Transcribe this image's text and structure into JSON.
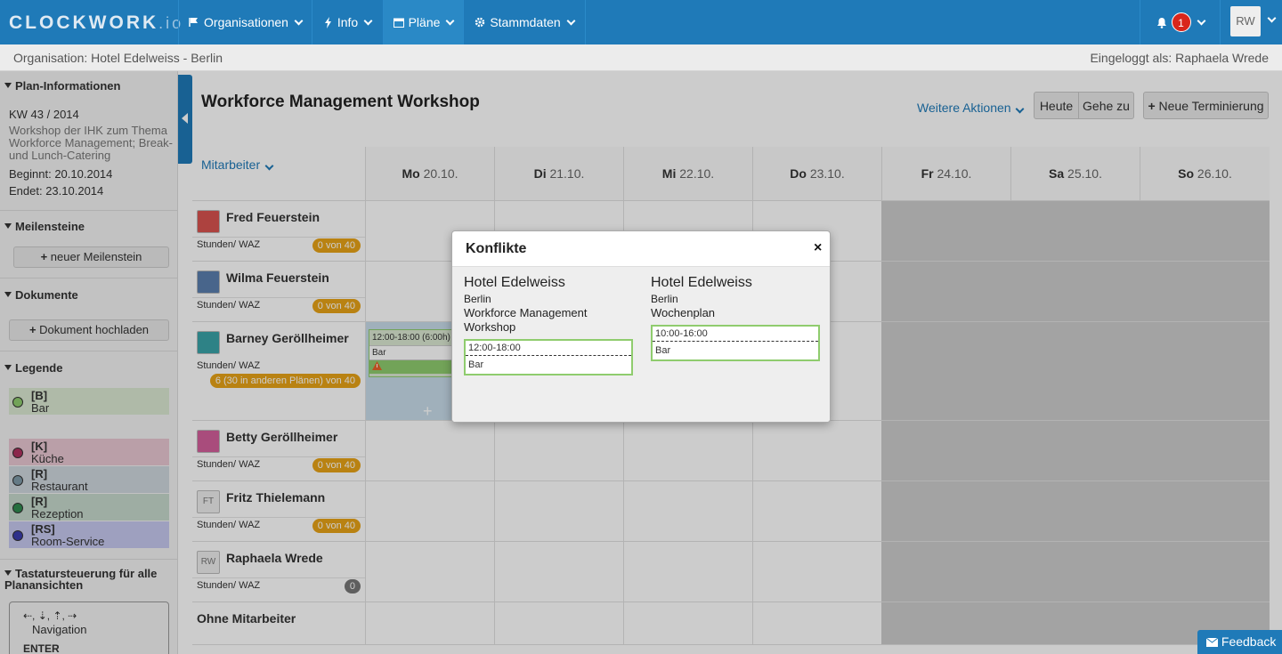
{
  "app": {
    "logo": "CL",
    "logo_o": "O",
    "logo_rest": "CKWORK",
    "logo_tld": ".io"
  },
  "nav": {
    "items": [
      {
        "label": "Organisationen",
        "icon": "flag-icon"
      },
      {
        "label": "Info",
        "icon": "bolt-icon"
      },
      {
        "label": "Pläne",
        "icon": "calendar-icon",
        "active": true
      },
      {
        "label": "Stammdaten",
        "icon": "gear-icon"
      }
    ],
    "notifications_count": "1",
    "user_initials": "RW"
  },
  "subbar": {
    "organisation": "Organisation: Hotel Edelweiss - Berlin",
    "logged_in": "Eingeloggt als: Raphaela Wrede"
  },
  "sidebar": {
    "plan_info": {
      "heading": "Plan-Informationen",
      "week": "KW 43 / 2014",
      "description": "Workshop der IHK zum Thema Workforce Management; Break- und Lunch-Catering",
      "begin": "Beginnt: 20.10.2014",
      "end": "Endet: 23.10.2014"
    },
    "milestones": {
      "heading": "Meilensteine",
      "button": "neuer Meilenstein"
    },
    "documents": {
      "heading": "Dokumente",
      "button": "Dokument hochladen"
    },
    "legend": {
      "heading": "Legende",
      "items": [
        {
          "code": "[B]",
          "name": "Bar",
          "color": "#dbe9d3",
          "dot": "#8fcc6e"
        },
        {
          "code": "[K]",
          "name": "Küche",
          "color": "#e9c7d2",
          "dot": "#b0305e"
        },
        {
          "code": "[R]",
          "name": "Restaurant",
          "color": "#cfd8de",
          "dot": "#7f9aa8"
        },
        {
          "code": "[R]",
          "name": "Rezeption",
          "color": "#c6d9cc",
          "dot": "#2e8b4e"
        },
        {
          "code": "[RS]",
          "name": "Room-Service",
          "color": "#c6c8ef",
          "dot": "#3a3cae"
        }
      ]
    },
    "keyboard": {
      "heading": "Tastatursteuerung für alle Planansichten",
      "keys": "⇠, ⇣, ⇡, ⇢",
      "nav_label": "Navigation",
      "enter": "ENTER"
    }
  },
  "main": {
    "title": "Workforce Management Workshop",
    "more_actions": "Weitere Aktionen",
    "today": "Heute",
    "goto": "Gehe zu",
    "new_schedule": "Neue Terminierung",
    "employees_label": "Mitarbeiter",
    "days": [
      {
        "dow": "Mo",
        "date": "20.10."
      },
      {
        "dow": "Di",
        "date": "21.10."
      },
      {
        "dow": "Mi",
        "date": "22.10."
      },
      {
        "dow": "Do",
        "date": "23.10."
      },
      {
        "dow": "Fr",
        "date": "24.10."
      },
      {
        "dow": "Sa",
        "date": "25.10."
      },
      {
        "dow": "So",
        "date": "26.10."
      }
    ],
    "employees": [
      {
        "name": "Fred Feuerstein",
        "hours_label": "Stunden/ WAZ",
        "hours": "0 von 40"
      },
      {
        "name": "Wilma Feuerstein",
        "hours_label": "Stunden/ WAZ",
        "hours": "0 von 40"
      },
      {
        "name": "Barney Geröllheimer",
        "hours_label": "Stunden/ WAZ",
        "hours": "6 (30 in anderen Plänen) von 40"
      },
      {
        "name": "Betty Geröllheimer",
        "hours_label": "Stunden/ WAZ",
        "hours": "0 von 40"
      },
      {
        "name": "Fritz Thielemann",
        "initials": "FT",
        "hours_label": "Stunden/ WAZ",
        "hours": "0 von 40"
      },
      {
        "name": "Raphaela Wrede",
        "initials": "RW",
        "hours_label": "Stunden/ WAZ",
        "hours": "0"
      },
      {
        "name": "Ohne Mitarbeiter"
      }
    ],
    "shift": {
      "time": "12:00-18:00 (6:00h)",
      "role": "Bar"
    }
  },
  "modal": {
    "title": "Konflikte",
    "close": "×",
    "conflicts": [
      {
        "org": "Hotel Edelweiss",
        "city": "Berlin",
        "plan": "Workforce Management Workshop",
        "time": "12:00-18:00",
        "role": "Bar"
      },
      {
        "org": "Hotel Edelweiss",
        "city": "Berlin",
        "plan": "Wochenplan",
        "time": "10:00-16:00",
        "role": "Bar"
      }
    ]
  },
  "feedback": "Feedback"
}
